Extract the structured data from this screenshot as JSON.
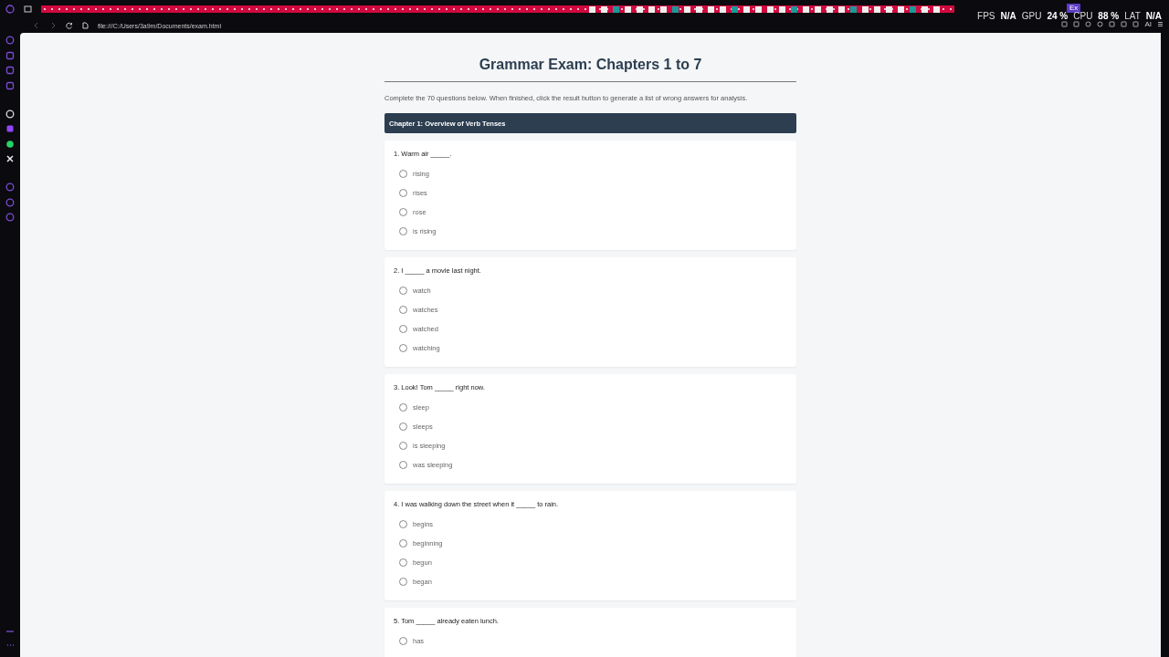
{
  "browser": {
    "active_tab": "Ex",
    "url": "file:///C:/Users/3a9m/Documents/exam.html",
    "toolbar_label": "AI"
  },
  "perf_overlay": [
    {
      "label": "FPS",
      "value": "N/A"
    },
    {
      "label": "GPU",
      "value": "24 %"
    },
    {
      "label": "CPU",
      "value": "88 %"
    },
    {
      "label": "LAT",
      "value": "N/A"
    }
  ],
  "exam": {
    "title": "Grammar Exam: Chapters 1 to 7",
    "intro": "Complete the 70 questions below. When finished, click the result button to generate a list of wrong answers for analysis.",
    "chapter": "Chapter 1: Overview of Verb Tenses",
    "questions": [
      {
        "text": "1. Warm air _____.",
        "options": [
          {
            "label": "rising",
            "selected": false
          },
          {
            "label": "rises",
            "selected": false
          },
          {
            "label": "rose",
            "selected": false
          },
          {
            "label": "is rising",
            "selected": false
          }
        ]
      },
      {
        "text": "2. I _____ a movie last night.",
        "options": [
          {
            "label": "watch",
            "selected": false
          },
          {
            "label": "watches",
            "selected": false
          },
          {
            "label": "watched",
            "selected": false
          },
          {
            "label": "watching",
            "selected": false
          }
        ]
      },
      {
        "text": "3. Look! Tom _____ right now.",
        "options": [
          {
            "label": "sleep",
            "selected": false
          },
          {
            "label": "sleeps",
            "selected": false
          },
          {
            "label": "is sleeping",
            "selected": false
          },
          {
            "label": "was sleeping",
            "selected": false
          }
        ]
      },
      {
        "text": "4. I was walking down the street when it _____ to rain.",
        "options": [
          {
            "label": "begins",
            "selected": false
          },
          {
            "label": "beginning",
            "selected": false
          },
          {
            "label": "begun",
            "selected": false
          },
          {
            "label": "began",
            "selected": false
          }
        ]
      },
      {
        "text": "5. Tom _____ already eaten lunch.",
        "options": [
          {
            "label": "has",
            "selected": false
          }
        ]
      }
    ]
  }
}
